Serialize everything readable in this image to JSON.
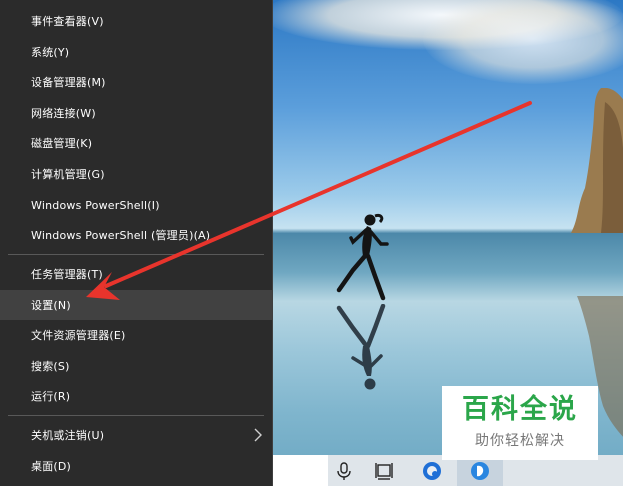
{
  "menu": {
    "items": [
      {
        "label": "事件查看器(V)"
      },
      {
        "label": "系统(Y)"
      },
      {
        "label": "设备管理器(M)"
      },
      {
        "label": "网络连接(W)"
      },
      {
        "label": "磁盘管理(K)"
      },
      {
        "label": "计算机管理(G)"
      },
      {
        "label": "Windows PowerShell(I)"
      },
      {
        "label": "Windows PowerShell (管理员)(A)"
      },
      {
        "label": "任务管理器(T)"
      },
      {
        "label": "设置(N)"
      },
      {
        "label": "文件资源管理器(E)"
      },
      {
        "label": "搜索(S)"
      },
      {
        "label": "运行(R)"
      },
      {
        "label": "关机或注销(U)"
      },
      {
        "label": "桌面(D)"
      }
    ],
    "highlighted": "设置(N)"
  },
  "taskbar": {
    "icons": [
      "microphone-icon",
      "task-view-icon",
      "browser-icon",
      "app-icon"
    ]
  },
  "watermark": {
    "title": "百科全说",
    "subtitle": "助你轻松解决"
  },
  "colors": {
    "menu_bg": "#2b2b2b",
    "menu_highlight": "#414141",
    "arrow": "#e8342c",
    "watermark_green": "#2ba64a"
  }
}
